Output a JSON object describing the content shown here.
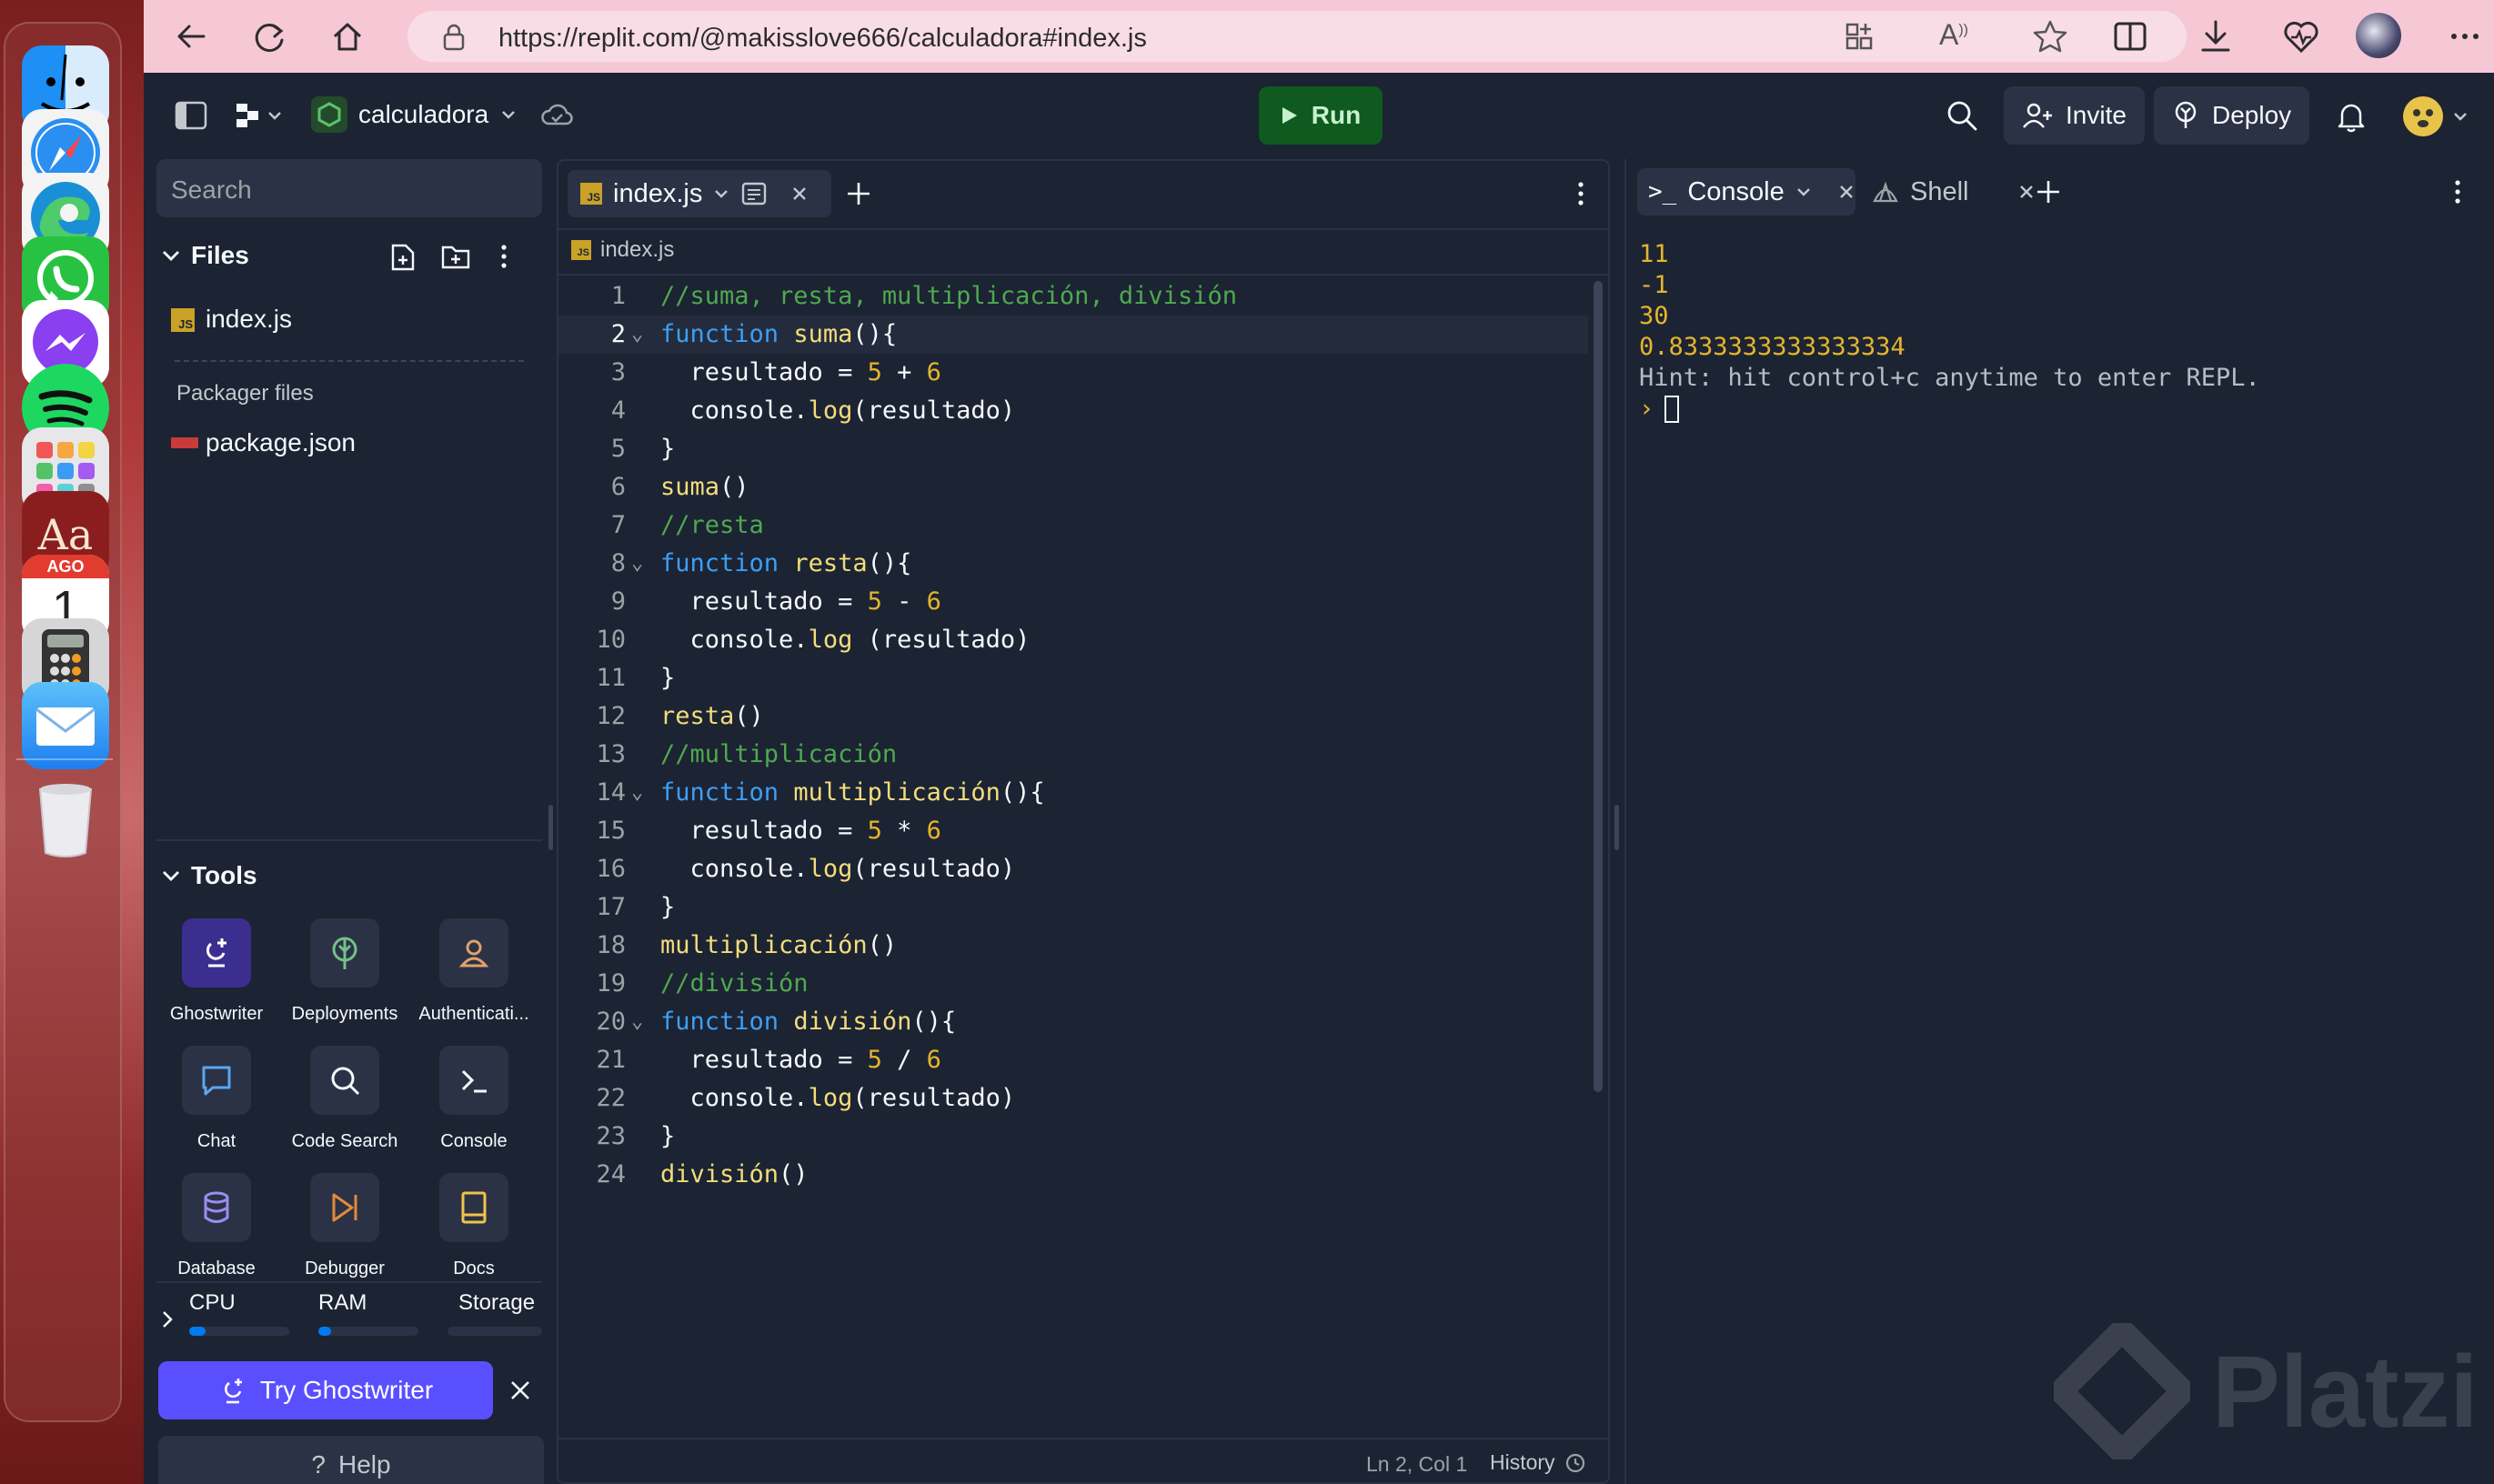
{
  "browser": {
    "url": "https://replit.com/@makisslove666/calculadora#index.js"
  },
  "header": {
    "project_name": "calculadora",
    "run_label": "Run",
    "invite_label": "Invite",
    "deploy_label": "Deploy"
  },
  "sidebar": {
    "search_placeholder": "Search",
    "files_label": "Files",
    "files": [
      "index.js"
    ],
    "packager_label": "Packager files",
    "packager_files": [
      "package.json"
    ],
    "tools_label": "Tools",
    "tools": [
      "Ghostwriter",
      "Deployments",
      "Authenticati...",
      "Chat",
      "Code Search",
      "Console",
      "Database",
      "Debugger",
      "Docs"
    ],
    "resources": [
      "CPU",
      "RAM",
      "Storage"
    ],
    "try_ghostwriter_label": "Try Ghostwriter",
    "help_label": "Help"
  },
  "editor": {
    "tab_label": "index.js",
    "breadcrumb": "index.js",
    "status_position": "Ln 2, Col 1",
    "history_label": "History",
    "lines": [
      "//suma, resta, multiplicación, división",
      "function suma(){",
      "  resultado = 5 + 6",
      "  console.log(resultado)",
      "}",
      "suma()",
      "//resta",
      "function resta(){",
      "  resultado = 5 - 6",
      "  console.log (resultado)",
      "}",
      "resta()",
      "//multiplicación",
      "function multiplicación(){",
      "  resultado = 5 * 6",
      "  console.log(resultado)",
      "}",
      "multiplicación()",
      "//división",
      "function división(){",
      "  resultado = 5 / 6",
      "  console.log(resultado)",
      "}",
      "división()"
    ]
  },
  "console": {
    "tab_console": "Console",
    "tab_shell": "Shell",
    "output": [
      "11",
      "-1",
      "30",
      "0.8333333333333334"
    ],
    "hint": "Hint: hit control+c anytime to enter REPL.",
    "prompt": "›"
  },
  "dock": {
    "calendar_month": "AGO",
    "calendar_day": "1",
    "dictionary_label": "Aa"
  },
  "watermark": "Platzi",
  "colors": {
    "bg": "#1c2333",
    "surface": "#2b3245",
    "keyword": "#3c9ff5",
    "function_name": "#f2dd7b",
    "comment": "#4ea94f",
    "number": "#e4b52b",
    "run_bg": "#0f5a1f",
    "tab_accent": "#5a4fff"
  }
}
